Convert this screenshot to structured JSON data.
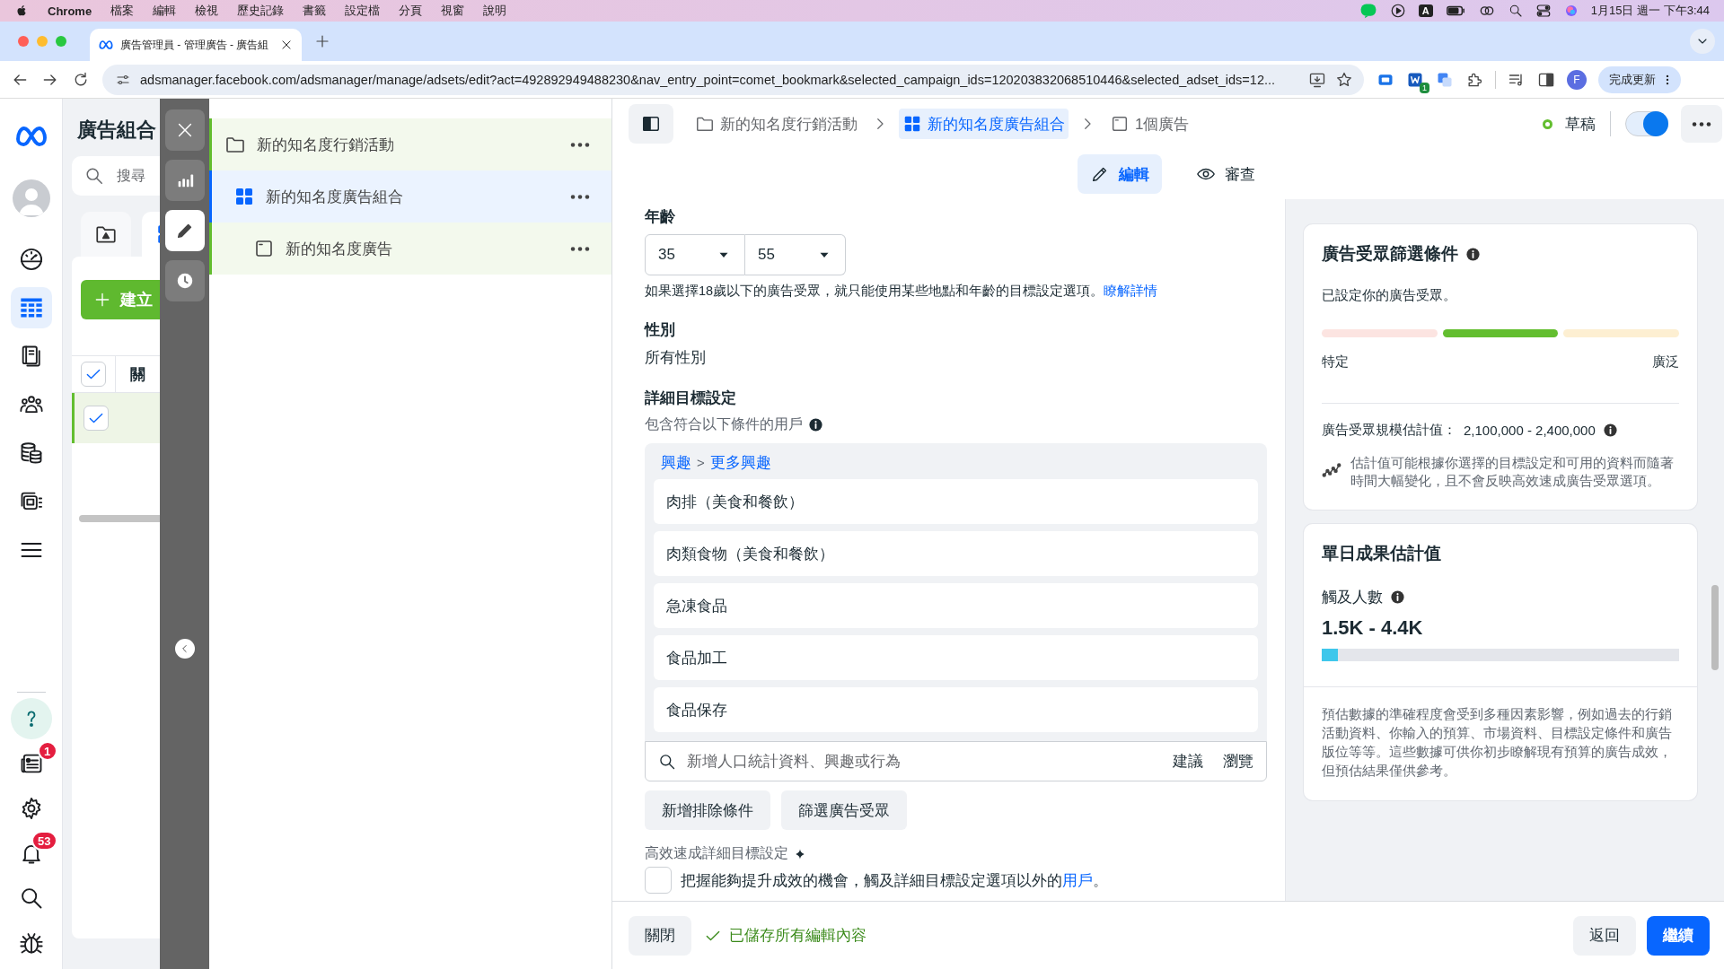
{
  "menubar": {
    "app": "Chrome",
    "menus": [
      "檔案",
      "編輯",
      "檢視",
      "歷史記錄",
      "書籤",
      "設定檔",
      "分頁",
      "視窗",
      "說明"
    ],
    "input_source": "A",
    "clock": "1月15日 週一 下午3:44"
  },
  "browser": {
    "tab_title": "廣告管理員 - 管理廣告 - 廣告組",
    "url": "adsmanager.facebook.com/adsmanager/manage/adsets/edit?act=492892949488230&nav_entry_point=comet_bookmark&selected_campaign_ids=120203832068510446&selected_adset_ids=12...",
    "extension_badge": "1",
    "profile": "F",
    "update_button": "完成更新"
  },
  "nav_rail": {
    "top": [
      {
        "kind": "gauge",
        "selected": false
      },
      {
        "kind": "table",
        "selected": true
      },
      {
        "kind": "document",
        "selected": false
      },
      {
        "kind": "people",
        "selected": false
      },
      {
        "kind": "coins",
        "selected": false
      },
      {
        "kind": "media",
        "selected": false
      },
      {
        "kind": "menu",
        "selected": false
      }
    ],
    "bottom": [
      {
        "kind": "help",
        "selected": false
      },
      {
        "kind": "newspaper",
        "selected": false,
        "badge": "1"
      },
      {
        "kind": "gear",
        "selected": false
      },
      {
        "kind": "bell",
        "selected": false,
        "badge": "53"
      },
      {
        "kind": "search",
        "selected": false
      },
      {
        "kind": "bug",
        "selected": false
      }
    ]
  },
  "background_panel": {
    "title": "廣告組合",
    "search_placeholder": "搜尋",
    "create_button": "建立",
    "column_header": "關",
    "header_checked": true,
    "rows": [
      {
        "checked": true
      }
    ]
  },
  "side_toolbar": [
    {
      "kind": "close",
      "selected": false
    },
    {
      "kind": "chart",
      "selected": false
    },
    {
      "kind": "edit",
      "selected": true
    },
    {
      "kind": "history",
      "selected": false
    }
  ],
  "tree": [
    {
      "kind": "campaign",
      "label": "新的知名度行銷活動",
      "selected": false,
      "children": [
        {
          "kind": "adset",
          "label": "新的知名度廣告組合",
          "selected": true,
          "children": [
            {
              "kind": "ad",
              "label": "新的知名度廣告",
              "selected": false
            }
          ]
        }
      ]
    }
  ],
  "breadcrumb": [
    {
      "kind": "campaign",
      "label": "新的知名度行銷活動",
      "selected": false
    },
    {
      "kind": "adset",
      "label": "新的知名度廣告組合",
      "selected": true
    },
    {
      "kind": "ad",
      "label": "1個廣告",
      "selected": false
    }
  ],
  "status": {
    "label": "草稿",
    "on": true
  },
  "mode_tabs": [
    {
      "kind": "edit",
      "label": "編輯",
      "selected": true
    },
    {
      "kind": "review",
      "label": "審查",
      "selected": false
    }
  ],
  "age": {
    "label": "年齡",
    "min": "35",
    "max": "55",
    "note": "如果選擇18歲以下的廣告受眾，就只能使用某些地點和年齡的目標設定選項。",
    "link": "瞭解詳情"
  },
  "gender": {
    "label": "性別",
    "value": "所有性別"
  },
  "detailed_targeting": {
    "label": "詳細目標設定",
    "subtitle": "包含符合以下條件的用戶",
    "path": [
      "興趣",
      "更多興趣"
    ],
    "separator": ">",
    "items": [
      "肉排（美食和餐飲）",
      "肉類食物（美食和餐飲）",
      "急凍食品",
      "食品加工",
      "食品保存"
    ],
    "search_placeholder": "新增人口統計資料、興趣或行為",
    "search_actions": [
      "建議",
      "瀏覽"
    ]
  },
  "buttons": [
    "新增排除條件",
    "篩選廣告受眾"
  ],
  "advantage": {
    "label": "高效速成詳細目標設定",
    "text": "把握能夠提升成效的機會，觸及詳細目標設定選項以外的",
    "link": "用戶",
    "end": "。",
    "checked": false
  },
  "audience_card": {
    "title": "廣告受眾篩選條件",
    "status": "已設定你的廣告受眾。",
    "segments": [
      {
        "color": "#fce4e1"
      },
      {
        "color": "#63be2f"
      },
      {
        "color": "#fdefd2"
      }
    ],
    "left_label": "特定",
    "right_label": "廣泛",
    "size_label": "廣告受眾規模估計值：",
    "size_value": "2,100,000 - 2,400,000",
    "note": "估計值可能根據你選擇的目標設定和可用的資料而隨著時間大幅變化，且不會反映高效速成廣告受眾選項。"
  },
  "results_card": {
    "title": "單日成果估計值",
    "metric_label": "觸及人數",
    "metric_value": "1.5K - 4.4K",
    "level": 0.045,
    "note": "預估數據的準確程度會受到多種因素影響，例如過去的行銷活動資料、你輸入的預算、市場資料、目標設定條件和廣告版位等等。這些數據可供你初步瞭解現有預算的廣告成效，但預估結果僅供參考。"
  },
  "footer": {
    "close": "關閉",
    "saved": "已儲存所有編輯內容",
    "back": "返回",
    "continue": "繼續"
  }
}
